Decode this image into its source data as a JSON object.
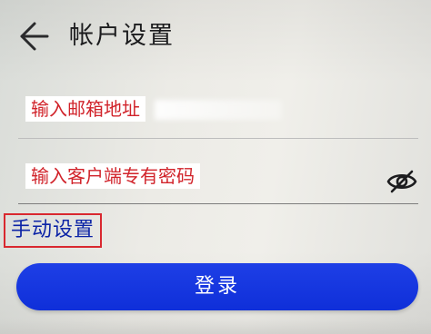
{
  "header": {
    "back_icon": "arrow-left-icon",
    "title": "帐户设置"
  },
  "form": {
    "email_placeholder": "输入邮箱地址",
    "password_placeholder": "输入客户端专有密码",
    "visibility_icon": "eye-off-icon"
  },
  "manual_setup": {
    "label": "手动设置"
  },
  "login_button": {
    "label": "登录"
  },
  "colors": {
    "primary_button": "#1436e0",
    "placeholder_text": "#d1232a",
    "link_text": "#0b23a6",
    "highlight_box": "#d9282f"
  }
}
